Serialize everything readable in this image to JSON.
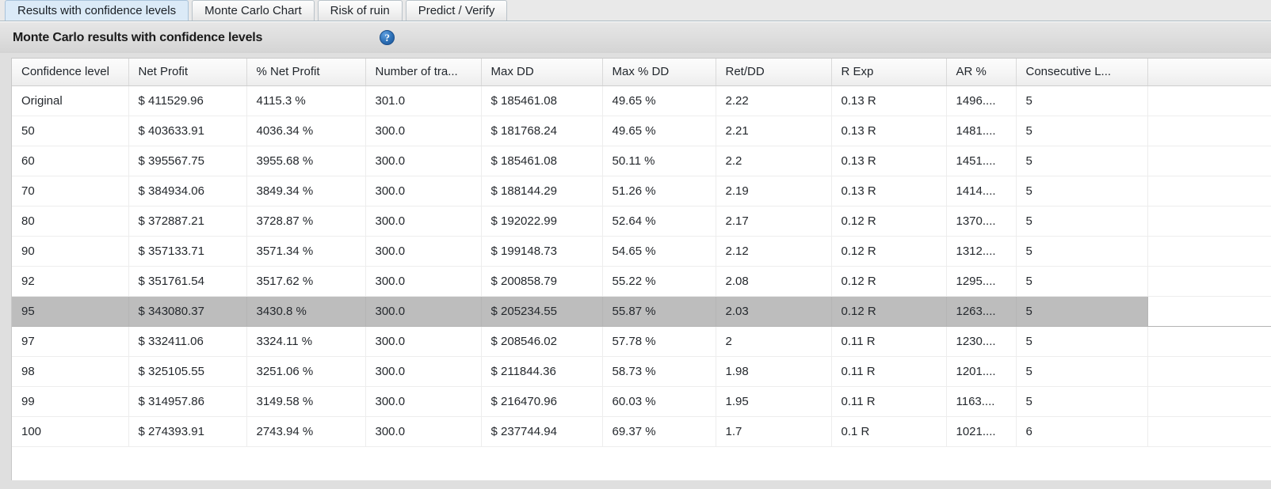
{
  "tabs": [
    {
      "label": "Results with confidence levels",
      "active": true
    },
    {
      "label": "Monte Carlo Chart",
      "active": false
    },
    {
      "label": "Risk of ruin",
      "active": false
    },
    {
      "label": "Predict / Verify",
      "active": false
    }
  ],
  "panel": {
    "title": "Monte Carlo results with confidence levels",
    "help_icon": "help-question-icon",
    "help_glyph": "?"
  },
  "colors": {
    "active_tab_bg": "#dbeaf7",
    "selected_row_bg": "#bdbdbd",
    "help_icon_blue": "#2c6fb5",
    "panel_bg": "#dfdfdf",
    "grid_bg": "#ffffff"
  },
  "table": {
    "columns": [
      "Confidence level",
      "Net Profit",
      "% Net Profit",
      "Number of tra...",
      "Max DD",
      "Max % DD",
      "Ret/DD",
      "R Exp",
      "AR %",
      "Consecutive L...",
      ""
    ],
    "selected_row_index": 7,
    "rows": [
      [
        "Original",
        "$ 411529.96",
        "4115.3 %",
        "301.0",
        "$ 185461.08",
        "49.65 %",
        "2.22",
        "0.13 R",
        "1496....",
        "5",
        ""
      ],
      [
        "50",
        "$ 403633.91",
        "4036.34 %",
        "300.0",
        "$ 181768.24",
        "49.65 %",
        "2.21",
        "0.13 R",
        "1481....",
        "5",
        ""
      ],
      [
        "60",
        "$ 395567.75",
        "3955.68 %",
        "300.0",
        "$ 185461.08",
        "50.11 %",
        "2.2",
        "0.13 R",
        "1451....",
        "5",
        ""
      ],
      [
        "70",
        "$ 384934.06",
        "3849.34 %",
        "300.0",
        "$ 188144.29",
        "51.26 %",
        "2.19",
        "0.13 R",
        "1414....",
        "5",
        ""
      ],
      [
        "80",
        "$ 372887.21",
        "3728.87 %",
        "300.0",
        "$ 192022.99",
        "52.64 %",
        "2.17",
        "0.12 R",
        "1370....",
        "5",
        ""
      ],
      [
        "90",
        "$ 357133.71",
        "3571.34 %",
        "300.0",
        "$ 199148.73",
        "54.65 %",
        "2.12",
        "0.12 R",
        "1312....",
        "5",
        ""
      ],
      [
        "92",
        "$ 351761.54",
        "3517.62 %",
        "300.0",
        "$ 200858.79",
        "55.22 %",
        "2.08",
        "0.12 R",
        "1295....",
        "5",
        ""
      ],
      [
        "95",
        "$ 343080.37",
        "3430.8 %",
        "300.0",
        "$ 205234.55",
        "55.87 %",
        "2.03",
        "0.12 R",
        "1263....",
        "5",
        ""
      ],
      [
        "97",
        "$ 332411.06",
        "3324.11 %",
        "300.0",
        "$ 208546.02",
        "57.78 %",
        "2",
        "0.11 R",
        "1230....",
        "5",
        ""
      ],
      [
        "98",
        "$ 325105.55",
        "3251.06 %",
        "300.0",
        "$ 211844.36",
        "58.73 %",
        "1.98",
        "0.11 R",
        "1201....",
        "5",
        ""
      ],
      [
        "99",
        "$ 314957.86",
        "3149.58 %",
        "300.0",
        "$ 216470.96",
        "60.03 %",
        "1.95",
        "0.11 R",
        "1163....",
        "5",
        ""
      ],
      [
        "100",
        "$ 274393.91",
        "2743.94 %",
        "300.0",
        "$ 237744.94",
        "69.37 %",
        "1.7",
        "0.1 R",
        "1021....",
        "6",
        ""
      ]
    ]
  }
}
